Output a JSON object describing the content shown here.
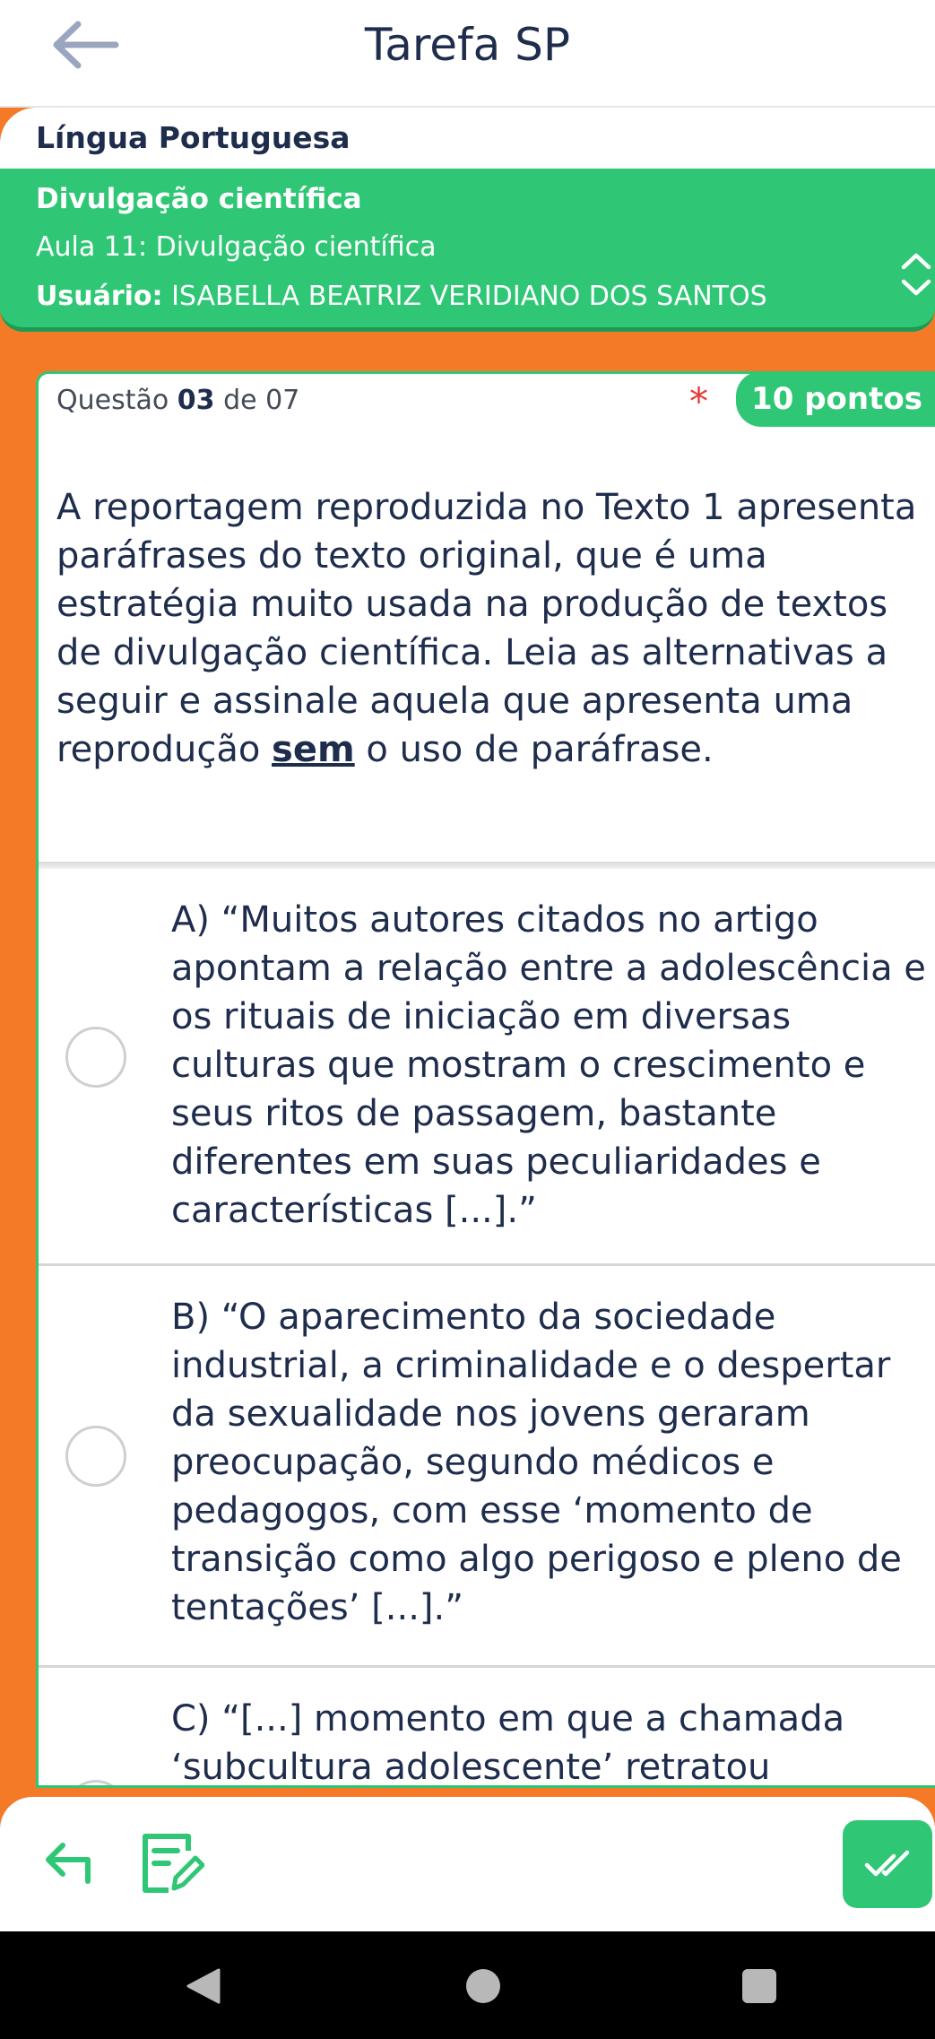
{
  "app": {
    "title": "Tarefa SP"
  },
  "lesson": {
    "subject": "Língua Portuguesa",
    "theme": "Divulgação científica",
    "name": "Aula 11: Divulgação científica",
    "user_label": "Usuário:",
    "user_name": "ISABELLA BEATRIZ VERIDIANO DOS SANTOS"
  },
  "question": {
    "counter_prefix": "Questão",
    "current": "03",
    "counter_mid": "de",
    "total": "07",
    "required_mark": "*",
    "points": "10 pontos",
    "statement_before": "A reportagem reproduzida no Texto 1 apresenta paráfrases do texto original, que é uma estratégia muito usada na produção de textos de divulgação científica. Leia as alternativas a seguir e assinale aquela que apresenta uma reprodução",
    "statement_highlight": "sem",
    "statement_after": "o uso de paráfrase.",
    "options": [
      {
        "text": "A) “Muitos autores citados no artigo apontam a relação entre a adolescência e os rituais de iniciação em diversas culturas que mostram o crescimento e seus ritos de passagem, bastante diferentes em suas peculiaridades e características [...].”"
      },
      {
        "text": "B) “O aparecimento da sociedade industrial, a criminalidade e o despertar da sexualidade nos jovens geraram preocupação, segundo médicos e pedagogos, com esse ‘momento de transição como algo perigoso e pleno de tentações’ [...].”"
      },
      {
        "text": "C) “[...] momento em que a chamada ‘subcultura adolescente’ retratou"
      }
    ]
  },
  "icons": {
    "back": "arrow-left-icon",
    "expand": "chevron-up-down-icon",
    "toolbar_back": "return-arrow-icon",
    "toolbar_edit": "edit-note-icon",
    "toolbar_submit": "double-check-icon",
    "nav_back": "triangle-back-icon",
    "nav_home": "circle-home-icon",
    "nav_recent": "square-recent-icon"
  },
  "colors": {
    "accent_green": "#2fc775",
    "background_orange": "#f47a28",
    "text_navy": "#1f2d4d",
    "required_red": "#e53935"
  }
}
